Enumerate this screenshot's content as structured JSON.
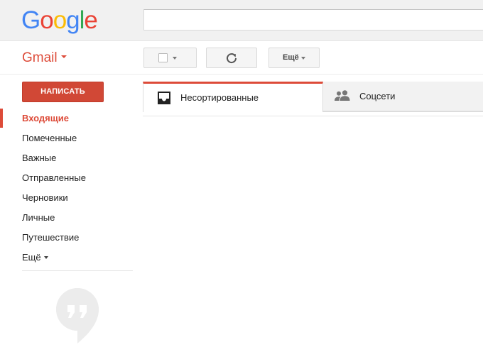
{
  "header": {
    "logo": {
      "letters": [
        "G",
        "o",
        "o",
        "g",
        "l",
        "e"
      ],
      "colors": [
        "#4285f4",
        "#ea4335",
        "#fbbc05",
        "#4285f4",
        "#34a853",
        "#ea4335"
      ]
    },
    "search": {
      "value": "",
      "placeholder": ""
    }
  },
  "app": {
    "label": "Gmail",
    "accent": "#dd4b39"
  },
  "toolbar": {
    "select_icon": "checkbox-icon",
    "refresh_icon": "refresh-icon",
    "more_label": "Ещё"
  },
  "sidebar": {
    "compose_label": "НАПИСАТЬ",
    "compose_color": "#d14836",
    "items": [
      {
        "label": "Входящие",
        "active": true
      },
      {
        "label": "Помеченные"
      },
      {
        "label": "Важные"
      },
      {
        "label": "Отправленные"
      },
      {
        "label": "Черновики"
      },
      {
        "label": "Личные"
      },
      {
        "label": "Путешествие"
      },
      {
        "label": "Ещё"
      }
    ],
    "hangouts_icon": "hangouts-icon"
  },
  "tabs": [
    {
      "label": "Несортированные",
      "icon": "inbox-tray-icon",
      "selected": true
    },
    {
      "label": "Соцсети",
      "icon": "people-icon",
      "selected": false
    }
  ]
}
